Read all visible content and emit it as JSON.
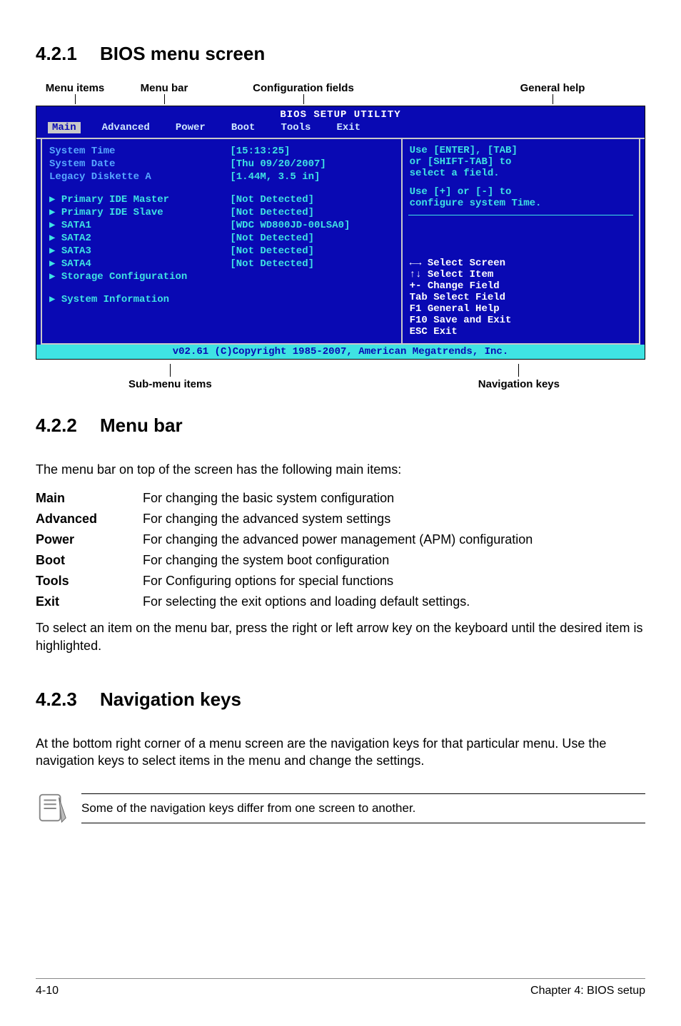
{
  "sections": {
    "s1": {
      "num": "4.2.1",
      "title": "BIOS menu screen"
    },
    "s2": {
      "num": "4.2.2",
      "title": "Menu bar"
    },
    "s3": {
      "num": "4.2.3",
      "title": "Navigation keys"
    }
  },
  "annot_top": {
    "a1": "Menu items",
    "a2": "Menu bar",
    "a3": "Configuration fields",
    "a4": "General help"
  },
  "annot_bottom": {
    "b1": "Sub-menu items",
    "b2": "Navigation keys"
  },
  "bios": {
    "title": "BIOS SETUP UTILITY",
    "tabs": {
      "main": "Main",
      "advanced": "Advanced",
      "power": "Power",
      "boot": "Boot",
      "tools": "Tools",
      "exit": "Exit"
    },
    "left_labels": {
      "system_time": "System Time",
      "system_date": "System Date",
      "legacy": "Legacy Diskette A",
      "pim": "Primary IDE Master",
      "pis": "Primary IDE Slave",
      "s1": "SATA1",
      "s2": "SATA2",
      "s3": "SATA3",
      "s4": "SATA4",
      "sc": "Storage Configuration",
      "si": "System Information"
    },
    "left_values": {
      "system_time": "[15:13:25]",
      "system_date": "[Thu 09/20/2007]",
      "legacy": "[1.44M, 3.5 in]",
      "pim": "[Not Detected]",
      "pis": "[Not Detected]",
      "s1": "[WDC WD800JD-00LSA0]",
      "s2": "[Not Detected]",
      "s3": "[Not Detected]",
      "s4": "[Not Detected]"
    },
    "help": {
      "l1": "Use [ENTER], [TAB]",
      "l2": "or [SHIFT-TAB] to",
      "l3": "select a field.",
      "l4": "Use [+] or [-] to",
      "l5": "configure system Time."
    },
    "keys": {
      "k1": "←→   Select Screen",
      "k2": "↑↓   Select Item",
      "k3": "+-   Change Field",
      "k4": "Tab  Select Field",
      "k5": "F1   General Help",
      "k6": "F10  Save and Exit",
      "k7": "ESC  Exit"
    },
    "footer": "v02.61 (C)Copyright 1985-2007, American Megatrends, Inc."
  },
  "menubar_intro": "The menu bar on top of the screen has the following main items:",
  "defs": {
    "main_k": "Main",
    "main_v": "For changing the basic system configuration",
    "adv_k": "Advanced",
    "adv_v": "For changing the advanced system settings",
    "pow_k": "Power",
    "pow_v": "For changing the advanced power management (APM) configuration",
    "boot_k": "Boot",
    "boot_v": "For changing the system boot configuration",
    "tools_k": "Tools",
    "tools_v": "For Configuring options for special functions",
    "exit_k": "Exit",
    "exit_v": "For selecting the exit options and loading default settings."
  },
  "menubar_outro": "To select an item on the menu bar, press the right or left arrow key on the keyboard until the desired item is highlighted.",
  "navkeys_body": "At the bottom right corner of a menu screen are the navigation keys for that particular menu. Use the navigation keys to select items in the menu and change the settings.",
  "note": "Some of the navigation keys differ from one screen to another.",
  "page_footer": {
    "left": "4-10",
    "right": "Chapter 4: BIOS setup"
  }
}
